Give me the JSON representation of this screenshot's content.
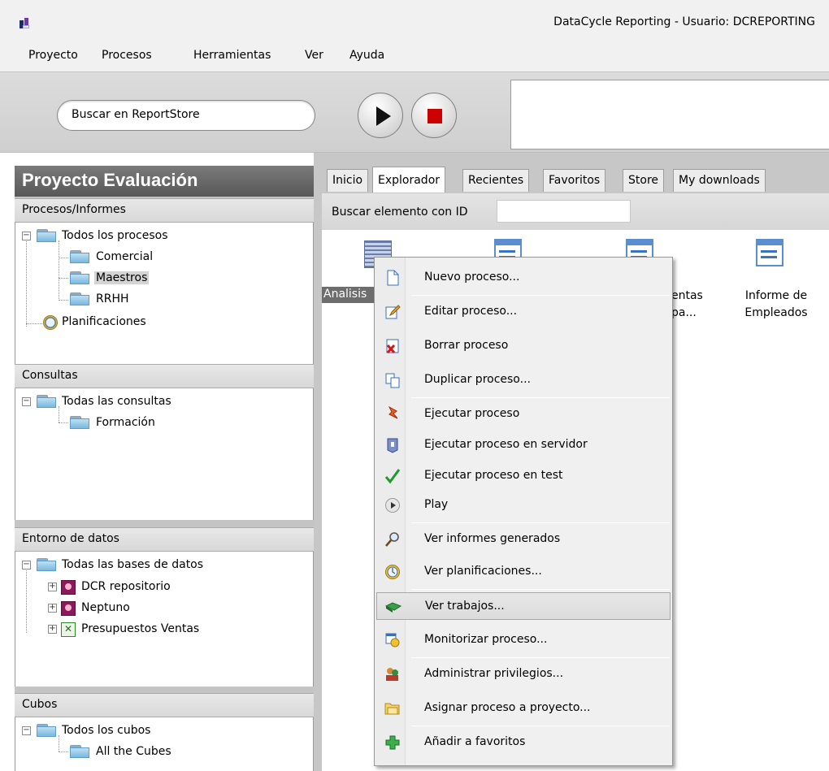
{
  "window": {
    "title": "DataCycle Reporting - Usuario: DCREPORTING"
  },
  "menubar": {
    "items": [
      "Proyecto",
      "Procesos",
      "Herramientas",
      "Ver",
      "Ayuda"
    ]
  },
  "toolbar": {
    "search_label": "Buscar en ReportStore"
  },
  "left": {
    "project_title": "Proyecto Evaluación",
    "sections": {
      "procesos": {
        "header": "Procesos/Informes",
        "root": "Todos los procesos",
        "children": [
          "Comercial",
          "Maestros",
          "RRHH"
        ],
        "extra": "Planificaciones"
      },
      "consultas": {
        "header": "Consultas",
        "root": "Todas las consultas",
        "children": [
          "Formación"
        ]
      },
      "entorno": {
        "header": "Entorno de datos",
        "root": "Todas las bases de datos",
        "children": [
          "DCR repositorio",
          "Neptuno",
          "Presupuestos Ventas"
        ]
      },
      "cubos": {
        "header": "Cubos",
        "root": "Todos los cubos",
        "children": [
          "All the Cubes"
        ]
      }
    }
  },
  "right": {
    "tabs": [
      "Inicio",
      "Explorador",
      "Recientes",
      "Favoritos",
      "Store",
      "My downloads"
    ],
    "active_tab": "Explorador",
    "id_search_label": "Buscar elemento con ID",
    "items": {
      "analisis": "Analisis",
      "item3_line1": "entas",
      "item3_line2": "pa...",
      "empleados_line1": "Informe de",
      "empleados_line2": "Empleados"
    }
  },
  "context_menu": {
    "items": [
      "Nuevo proceso...",
      "Editar proceso...",
      "Borrar proceso",
      "Duplicar proceso...",
      "Ejecutar proceso",
      "Ejecutar proceso en servidor",
      "Ejecutar proceso en test",
      "Play",
      "Ver informes generados",
      "Ver planificaciones...",
      "Ver trabajos...",
      "Monitorizar proceso...",
      "Administrar privilegios...",
      "Asignar proceso a proyecto...",
      "Añadir a favoritos"
    ],
    "hovered": "Ver trabajos..."
  }
}
